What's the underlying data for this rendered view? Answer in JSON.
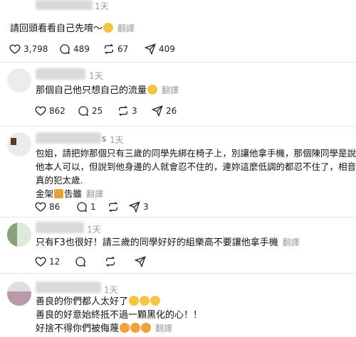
{
  "translate_label": "翻譯",
  "top": {
    "time": "1天",
    "text": "請回頭看看自己先唷～",
    "likes": "3,798",
    "comments": "489",
    "reposts": "67",
    "shares": "409"
  },
  "replies": [
    {
      "time": "1天",
      "lines": [
        "那個自己他只想自己的流量"
      ],
      "likes": "862",
      "comments": "25",
      "reposts": "3",
      "shares": "26"
    },
    {
      "time": "1天",
      "name_tail": "s",
      "lines": [
        "包姐，請把妳那個只有三歲的同學先綁在椅子上，別讓他拿手機，那個陳同學是說",
        "他本人可以，但說到他身邊的人就會忍不住的，連妳這麼低調的都忍不住了，相音",
        "真的犯太歲."
      ],
      "extra_line_before": "金架",
      "extra_line_after": "告雖",
      "likes": "86",
      "comments": "1",
      "reposts": "",
      "shares": "3"
    },
    {
      "time": "1天",
      "lines": [
        "只有F3也很好！請三歲的同學好好的組樂高不要讓他拿手機"
      ],
      "likes": "12",
      "comments": "",
      "reposts": "",
      "shares": ""
    },
    {
      "time": "1天",
      "lines": [
        "善良的你們都人太好了",
        "善良的好意始終抵不過一顆黑化的心！！",
        "好捨不得你們被侮蔑"
      ]
    }
  ]
}
